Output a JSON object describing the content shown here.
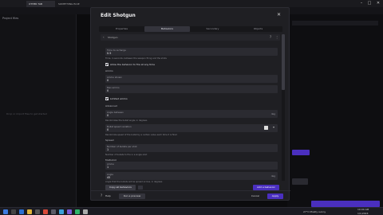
{
  "browser": {
    "tabs": [
      "",
      "OTHER TAB",
      "SOMETHING ELSE"
    ]
  },
  "left_panel": {
    "title": "Project files",
    "empty_message": "Drop or import files to get started"
  },
  "dialog": {
    "title": "Edit Shotgun",
    "tabs": [
      "Properties",
      "Behaviors",
      "Secondary",
      "Objects"
    ],
    "active_tab": "Behaviors",
    "preview_value": "Shotgun",
    "fields": [
      {
        "label": "Time to recharge",
        "value": "0.5",
        "help": "Time, in seconds, between the weapon firing and the shots"
      },
      {
        "label": "Ammo shown",
        "value": "0",
        "help": ""
      },
      {
        "label": "Max ammo",
        "value": "0",
        "help": ""
      },
      {
        "label": "Angle between",
        "value": "0",
        "unit": "deg",
        "help": "Randomizes the bullet angle, in degrees"
      },
      {
        "label": "Bullet speed variation",
        "value": "0",
        "unit": "",
        "help": "Randomize speed of the bullet by a certain value each time it is fired"
      },
      {
        "label": "Number of bullets per shot",
        "value": "1",
        "help": "Number of bullets to fire in a single shot"
      },
      {
        "label": "Ammo",
        "value": "1",
        "help": "Number of ammo to shoot at once"
      },
      {
        "label": "Angle",
        "value": "45",
        "unit": "deg",
        "help": "Angle that the bullets will be spread across, in degrees"
      }
    ],
    "checkboxes": [
      {
        "label": "Allow the behavior to fire at any time",
        "checked": true
      },
      {
        "label": "Limited ammo",
        "checked": true
      }
    ],
    "section_labels": [
      "Ammo",
      "Advanced",
      "Spread",
      "Multishot"
    ],
    "footer": {
      "help_label": "Help",
      "preview_label": "Run a preview",
      "apply_label": "Apply",
      "cancel_label": "Cancel",
      "add_behavior_label": "Add a behavior",
      "pin_label": "Copy all behaviors"
    }
  },
  "taskbar": {
    "weather": "27°C  Mostly sunny",
    "time": "10:00 AM",
    "date": "1/1/2024"
  },
  "colors": {
    "accent": "#4a2fbf",
    "background": "#0b0b0d",
    "dialog": "#1f1f23"
  }
}
